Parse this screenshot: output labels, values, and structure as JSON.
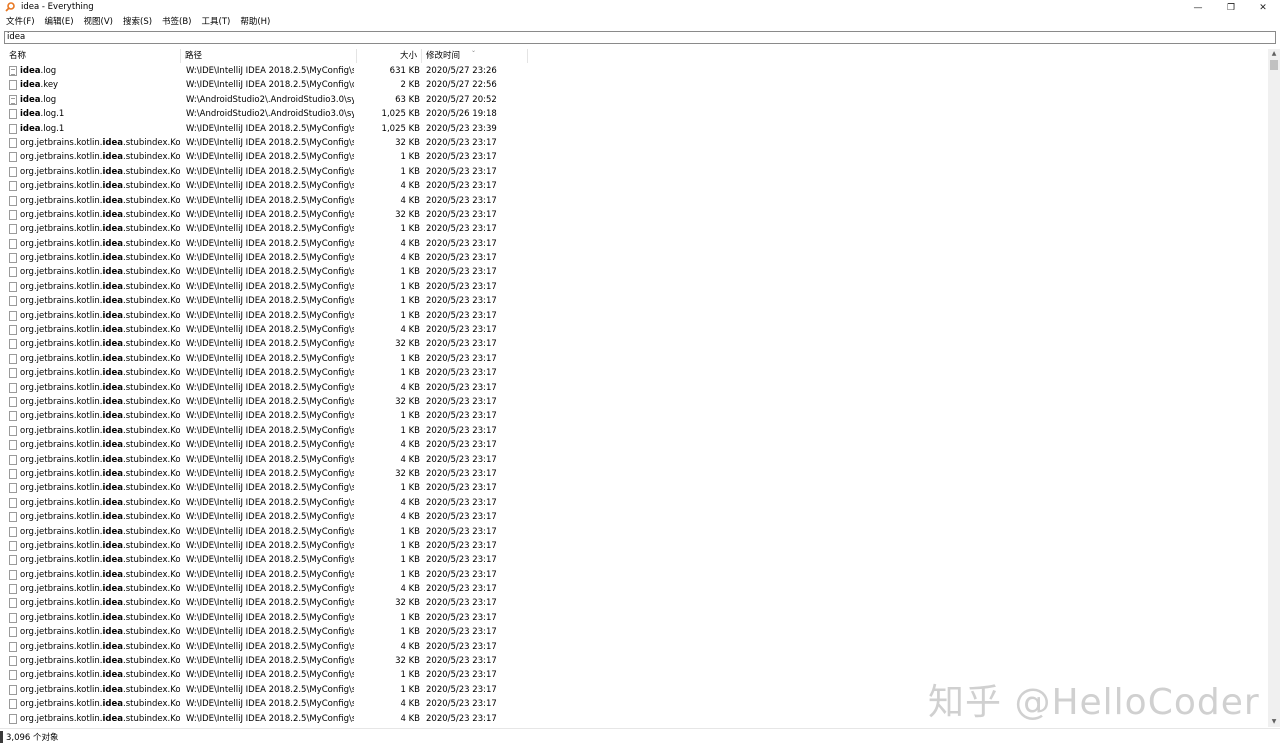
{
  "window": {
    "title": "idea - Everything",
    "controls": {
      "minimize": "—",
      "restore": "❐",
      "close": "✕"
    }
  },
  "menu": [
    "文件(F)",
    "编辑(E)",
    "视图(V)",
    "搜索(S)",
    "书签(B)",
    "工具(T)",
    "帮助(H)"
  ],
  "search": {
    "value": "idea"
  },
  "columns": {
    "name": "名称",
    "path": "路径",
    "size": "大小",
    "modified": "修改时间"
  },
  "files": [
    {
      "pre": "",
      "hl": "idea",
      "post": ".log",
      "path": "W:\\IDE\\IntelliJ IDEA 2018.2.5\\MyConfig\\s...",
      "size": "631 KB",
      "date": "2020/5/27 23:26",
      "icon": "text-file-icon"
    },
    {
      "pre": "",
      "hl": "idea",
      "post": ".key",
      "path": "W:\\IDE\\IntelliJ IDEA 2018.2.5\\MyConfig\\c...",
      "size": "2 KB",
      "date": "2020/5/27 22:56",
      "icon": "file-icon"
    },
    {
      "pre": "",
      "hl": "idea",
      "post": ".log",
      "path": "W:\\AndroidStudio2\\.AndroidStudio3.0\\sy...",
      "size": "63 KB",
      "date": "2020/5/27 20:52",
      "icon": "text-file-icon"
    },
    {
      "pre": "",
      "hl": "idea",
      "post": ".log.1",
      "path": "W:\\AndroidStudio2\\.AndroidStudio3.0\\sy...",
      "size": "1,025 KB",
      "date": "2020/5/26 19:18",
      "icon": "file-icon"
    },
    {
      "pre": "",
      "hl": "idea",
      "post": ".log.1",
      "path": "W:\\IDE\\IntelliJ IDEA 2018.2.5\\MyConfig\\s...",
      "size": "1,025 KB",
      "date": "2020/5/23 23:39",
      "icon": "file-icon"
    },
    {
      "pre": "org.jetbrains.kotlin.",
      "hl": "idea",
      "post": ".stubindex.Kotl...",
      "path": "W:\\IDE\\IntelliJ IDEA 2018.2.5\\MyConfig\\s...",
      "size": "32 KB",
      "date": "2020/5/23 23:17",
      "icon": "file-icon"
    },
    {
      "pre": "org.jetbrains.kotlin.",
      "hl": "idea",
      "post": ".stubindex.Kotl...",
      "path": "W:\\IDE\\IntelliJ IDEA 2018.2.5\\MyConfig\\s...",
      "size": "1 KB",
      "date": "2020/5/23 23:17",
      "icon": "file-icon"
    },
    {
      "pre": "org.jetbrains.kotlin.",
      "hl": "idea",
      "post": ".stubindex.Kotl...",
      "path": "W:\\IDE\\IntelliJ IDEA 2018.2.5\\MyConfig\\s...",
      "size": "1 KB",
      "date": "2020/5/23 23:17",
      "icon": "file-icon"
    },
    {
      "pre": "org.jetbrains.kotlin.",
      "hl": "idea",
      "post": ".stubindex.Kotl...",
      "path": "W:\\IDE\\IntelliJ IDEA 2018.2.5\\MyConfig\\s...",
      "size": "4 KB",
      "date": "2020/5/23 23:17",
      "icon": "file-icon"
    },
    {
      "pre": "org.jetbrains.kotlin.",
      "hl": "idea",
      "post": ".stubindex.Kotl...",
      "path": "W:\\IDE\\IntelliJ IDEA 2018.2.5\\MyConfig\\s...",
      "size": "4 KB",
      "date": "2020/5/23 23:17",
      "icon": "file-icon"
    },
    {
      "pre": "org.jetbrains.kotlin.",
      "hl": "idea",
      "post": ".stubindex.Kotl...",
      "path": "W:\\IDE\\IntelliJ IDEA 2018.2.5\\MyConfig\\s...",
      "size": "32 KB",
      "date": "2020/5/23 23:17",
      "icon": "file-icon"
    },
    {
      "pre": "org.jetbrains.kotlin.",
      "hl": "idea",
      "post": ".stubindex.Kotl...",
      "path": "W:\\IDE\\IntelliJ IDEA 2018.2.5\\MyConfig\\s...",
      "size": "1 KB",
      "date": "2020/5/23 23:17",
      "icon": "file-icon"
    },
    {
      "pre": "org.jetbrains.kotlin.",
      "hl": "idea",
      "post": ".stubindex.Kotl...",
      "path": "W:\\IDE\\IntelliJ IDEA 2018.2.5\\MyConfig\\s...",
      "size": "4 KB",
      "date": "2020/5/23 23:17",
      "icon": "file-icon"
    },
    {
      "pre": "org.jetbrains.kotlin.",
      "hl": "idea",
      "post": ".stubindex.Kotl...",
      "path": "W:\\IDE\\IntelliJ IDEA 2018.2.5\\MyConfig\\s...",
      "size": "4 KB",
      "date": "2020/5/23 23:17",
      "icon": "file-icon"
    },
    {
      "pre": "org.jetbrains.kotlin.",
      "hl": "idea",
      "post": ".stubindex.Kotl...",
      "path": "W:\\IDE\\IntelliJ IDEA 2018.2.5\\MyConfig\\s...",
      "size": "1 KB",
      "date": "2020/5/23 23:17",
      "icon": "file-icon"
    },
    {
      "pre": "org.jetbrains.kotlin.",
      "hl": "idea",
      "post": ".stubindex.Kotl...",
      "path": "W:\\IDE\\IntelliJ IDEA 2018.2.5\\MyConfig\\s...",
      "size": "1 KB",
      "date": "2020/5/23 23:17",
      "icon": "file-icon"
    },
    {
      "pre": "org.jetbrains.kotlin.",
      "hl": "idea",
      "post": ".stubindex.Kotl...",
      "path": "W:\\IDE\\IntelliJ IDEA 2018.2.5\\MyConfig\\s...",
      "size": "1 KB",
      "date": "2020/5/23 23:17",
      "icon": "file-icon"
    },
    {
      "pre": "org.jetbrains.kotlin.",
      "hl": "idea",
      "post": ".stubindex.Kotl...",
      "path": "W:\\IDE\\IntelliJ IDEA 2018.2.5\\MyConfig\\s...",
      "size": "1 KB",
      "date": "2020/5/23 23:17",
      "icon": "file-icon"
    },
    {
      "pre": "org.jetbrains.kotlin.",
      "hl": "idea",
      "post": ".stubindex.Kotl...",
      "path": "W:\\IDE\\IntelliJ IDEA 2018.2.5\\MyConfig\\s...",
      "size": "4 KB",
      "date": "2020/5/23 23:17",
      "icon": "file-icon"
    },
    {
      "pre": "org.jetbrains.kotlin.",
      "hl": "idea",
      "post": ".stubindex.Kotl...",
      "path": "W:\\IDE\\IntelliJ IDEA 2018.2.5\\MyConfig\\s...",
      "size": "32 KB",
      "date": "2020/5/23 23:17",
      "icon": "file-icon"
    },
    {
      "pre": "org.jetbrains.kotlin.",
      "hl": "idea",
      "post": ".stubindex.Kotl...",
      "path": "W:\\IDE\\IntelliJ IDEA 2018.2.5\\MyConfig\\s...",
      "size": "1 KB",
      "date": "2020/5/23 23:17",
      "icon": "file-icon"
    },
    {
      "pre": "org.jetbrains.kotlin.",
      "hl": "idea",
      "post": ".stubindex.Kotl...",
      "path": "W:\\IDE\\IntelliJ IDEA 2018.2.5\\MyConfig\\s...",
      "size": "1 KB",
      "date": "2020/5/23 23:17",
      "icon": "file-icon"
    },
    {
      "pre": "org.jetbrains.kotlin.",
      "hl": "idea",
      "post": ".stubindex.Kotl...",
      "path": "W:\\IDE\\IntelliJ IDEA 2018.2.5\\MyConfig\\s...",
      "size": "4 KB",
      "date": "2020/5/23 23:17",
      "icon": "file-icon"
    },
    {
      "pre": "org.jetbrains.kotlin.",
      "hl": "idea",
      "post": ".stubindex.Kotl...",
      "path": "W:\\IDE\\IntelliJ IDEA 2018.2.5\\MyConfig\\s...",
      "size": "32 KB",
      "date": "2020/5/23 23:17",
      "icon": "file-icon"
    },
    {
      "pre": "org.jetbrains.kotlin.",
      "hl": "idea",
      "post": ".stubindex.Kotl...",
      "path": "W:\\IDE\\IntelliJ IDEA 2018.2.5\\MyConfig\\s...",
      "size": "1 KB",
      "date": "2020/5/23 23:17",
      "icon": "file-icon"
    },
    {
      "pre": "org.jetbrains.kotlin.",
      "hl": "idea",
      "post": ".stubindex.Kotl...",
      "path": "W:\\IDE\\IntelliJ IDEA 2018.2.5\\MyConfig\\s...",
      "size": "1 KB",
      "date": "2020/5/23 23:17",
      "icon": "file-icon"
    },
    {
      "pre": "org.jetbrains.kotlin.",
      "hl": "idea",
      "post": ".stubindex.Kotl...",
      "path": "W:\\IDE\\IntelliJ IDEA 2018.2.5\\MyConfig\\s...",
      "size": "4 KB",
      "date": "2020/5/23 23:17",
      "icon": "file-icon"
    },
    {
      "pre": "org.jetbrains.kotlin.",
      "hl": "idea",
      "post": ".stubindex.Kotl...",
      "path": "W:\\IDE\\IntelliJ IDEA 2018.2.5\\MyConfig\\s...",
      "size": "4 KB",
      "date": "2020/5/23 23:17",
      "icon": "file-icon"
    },
    {
      "pre": "org.jetbrains.kotlin.",
      "hl": "idea",
      "post": ".stubindex.Kotl...",
      "path": "W:\\IDE\\IntelliJ IDEA 2018.2.5\\MyConfig\\s...",
      "size": "32 KB",
      "date": "2020/5/23 23:17",
      "icon": "file-icon"
    },
    {
      "pre": "org.jetbrains.kotlin.",
      "hl": "idea",
      "post": ".stubindex.Kotl...",
      "path": "W:\\IDE\\IntelliJ IDEA 2018.2.5\\MyConfig\\s...",
      "size": "1 KB",
      "date": "2020/5/23 23:17",
      "icon": "file-icon"
    },
    {
      "pre": "org.jetbrains.kotlin.",
      "hl": "idea",
      "post": ".stubindex.Kotl...",
      "path": "W:\\IDE\\IntelliJ IDEA 2018.2.5\\MyConfig\\s...",
      "size": "4 KB",
      "date": "2020/5/23 23:17",
      "icon": "file-icon"
    },
    {
      "pre": "org.jetbrains.kotlin.",
      "hl": "idea",
      "post": ".stubindex.Kotl...",
      "path": "W:\\IDE\\IntelliJ IDEA 2018.2.5\\MyConfig\\s...",
      "size": "4 KB",
      "date": "2020/5/23 23:17",
      "icon": "file-icon"
    },
    {
      "pre": "org.jetbrains.kotlin.",
      "hl": "idea",
      "post": ".stubindex.Kotl...",
      "path": "W:\\IDE\\IntelliJ IDEA 2018.2.5\\MyConfig\\s...",
      "size": "1 KB",
      "date": "2020/5/23 23:17",
      "icon": "file-icon"
    },
    {
      "pre": "org.jetbrains.kotlin.",
      "hl": "idea",
      "post": ".stubindex.Kotl...",
      "path": "W:\\IDE\\IntelliJ IDEA 2018.2.5\\MyConfig\\s...",
      "size": "1 KB",
      "date": "2020/5/23 23:17",
      "icon": "file-icon"
    },
    {
      "pre": "org.jetbrains.kotlin.",
      "hl": "idea",
      "post": ".stubindex.Kotl...",
      "path": "W:\\IDE\\IntelliJ IDEA 2018.2.5\\MyConfig\\s...",
      "size": "1 KB",
      "date": "2020/5/23 23:17",
      "icon": "file-icon"
    },
    {
      "pre": "org.jetbrains.kotlin.",
      "hl": "idea",
      "post": ".stubindex.Kotl...",
      "path": "W:\\IDE\\IntelliJ IDEA 2018.2.5\\MyConfig\\s...",
      "size": "1 KB",
      "date": "2020/5/23 23:17",
      "icon": "file-icon"
    },
    {
      "pre": "org.jetbrains.kotlin.",
      "hl": "idea",
      "post": ".stubindex.Kotl...",
      "path": "W:\\IDE\\IntelliJ IDEA 2018.2.5\\MyConfig\\s...",
      "size": "4 KB",
      "date": "2020/5/23 23:17",
      "icon": "file-icon"
    },
    {
      "pre": "org.jetbrains.kotlin.",
      "hl": "idea",
      "post": ".stubindex.Kotl...",
      "path": "W:\\IDE\\IntelliJ IDEA 2018.2.5\\MyConfig\\s...",
      "size": "32 KB",
      "date": "2020/5/23 23:17",
      "icon": "file-icon"
    },
    {
      "pre": "org.jetbrains.kotlin.",
      "hl": "idea",
      "post": ".stubindex.Kotl...",
      "path": "W:\\IDE\\IntelliJ IDEA 2018.2.5\\MyConfig\\s...",
      "size": "1 KB",
      "date": "2020/5/23 23:17",
      "icon": "file-icon"
    },
    {
      "pre": "org.jetbrains.kotlin.",
      "hl": "idea",
      "post": ".stubindex.Kotl...",
      "path": "W:\\IDE\\IntelliJ IDEA 2018.2.5\\MyConfig\\s...",
      "size": "1 KB",
      "date": "2020/5/23 23:17",
      "icon": "file-icon"
    },
    {
      "pre": "org.jetbrains.kotlin.",
      "hl": "idea",
      "post": ".stubindex.Kotl...",
      "path": "W:\\IDE\\IntelliJ IDEA 2018.2.5\\MyConfig\\s...",
      "size": "4 KB",
      "date": "2020/5/23 23:17",
      "icon": "file-icon"
    },
    {
      "pre": "org.jetbrains.kotlin.",
      "hl": "idea",
      "post": ".stubindex.Kotl...",
      "path": "W:\\IDE\\IntelliJ IDEA 2018.2.5\\MyConfig\\s...",
      "size": "32 KB",
      "date": "2020/5/23 23:17",
      "icon": "file-icon"
    },
    {
      "pre": "org.jetbrains.kotlin.",
      "hl": "idea",
      "post": ".stubindex.Kotl...",
      "path": "W:\\IDE\\IntelliJ IDEA 2018.2.5\\MyConfig\\s...",
      "size": "1 KB",
      "date": "2020/5/23 23:17",
      "icon": "file-icon"
    },
    {
      "pre": "org.jetbrains.kotlin.",
      "hl": "idea",
      "post": ".stubindex.Kotl...",
      "path": "W:\\IDE\\IntelliJ IDEA 2018.2.5\\MyConfig\\s...",
      "size": "1 KB",
      "date": "2020/5/23 23:17",
      "icon": "file-icon"
    },
    {
      "pre": "org.jetbrains.kotlin.",
      "hl": "idea",
      "post": ".stubindex.Kotl...",
      "path": "W:\\IDE\\IntelliJ IDEA 2018.2.5\\MyConfig\\s...",
      "size": "4 KB",
      "date": "2020/5/23 23:17",
      "icon": "file-icon"
    },
    {
      "pre": "org.jetbrains.kotlin.",
      "hl": "idea",
      "post": ".stubindex.Kotl...",
      "path": "W:\\IDE\\IntelliJ IDEA 2018.2.5\\MyConfig\\s...",
      "size": "4 KB",
      "date": "2020/5/23 23:17",
      "icon": "file-icon"
    }
  ],
  "status": {
    "text": "3,096 个对象"
  },
  "watermark": "知乎 @HelloCoder",
  "colors": {
    "app_icon": "#e87722",
    "highlight_text": "#000000"
  }
}
